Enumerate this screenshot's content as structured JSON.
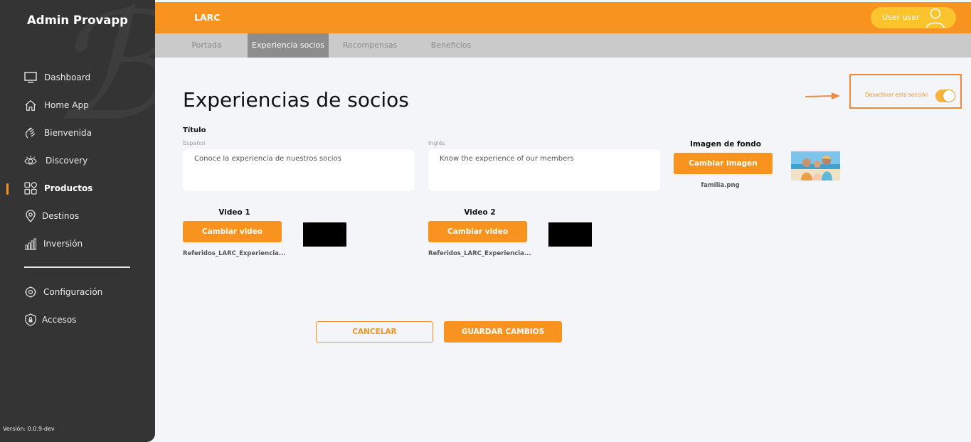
{
  "sidebar": {
    "brand": "Admin Provapp",
    "items": [
      {
        "label": "Dashboard",
        "icon": "monitor-icon"
      },
      {
        "label": "Home App",
        "icon": "home-icon"
      },
      {
        "label": "Bienvenida",
        "icon": "wave-hand-icon"
      },
      {
        "label": "Discovery",
        "icon": "eye-icon"
      },
      {
        "label": "Productos",
        "icon": "grid-icon",
        "active": true
      },
      {
        "label": "Destinos",
        "icon": "map-pin-icon"
      },
      {
        "label": "Inversión",
        "icon": "bar-chart-icon"
      },
      {
        "label": "Configuración",
        "icon": "gear-icon"
      },
      {
        "label": "Accesos",
        "icon": "shield-lock-icon"
      }
    ],
    "version": "Versión: 0.0.9-dev"
  },
  "header": {
    "app_name": "LARC",
    "user_name": "User user"
  },
  "tabs": [
    {
      "label": "Portada"
    },
    {
      "label": "Experiencia socios",
      "active": true
    },
    {
      "label": "Recompensas"
    },
    {
      "label": "Beneficios"
    }
  ],
  "main": {
    "title": "Experiencias de socios",
    "toggle_label": "Desactivar esta sección",
    "toggle_on": true,
    "field_title": "Título",
    "spanish_label": "Español",
    "spanish_value": "Conoce la experiencia de nuestros socios",
    "english_label": "Inglés",
    "english_value": "Know the experience of our members",
    "background": {
      "label": "Imagen de fondo",
      "button": "Cambiar imagen",
      "filename": "familia.png"
    },
    "video1": {
      "label": "Video 1",
      "button": "Cambiar video",
      "filename": "Referidos_LARC_Experiencia..."
    },
    "video2": {
      "label": "Video 2",
      "button": "Cambiar video",
      "filename": "Referidos_LARC_Experiencia..."
    },
    "cancel": "CANCELAR",
    "save": "GUARDAR CAMBIOS"
  },
  "colors": {
    "accent": "#f7931e",
    "sidebar_bg": "#343434",
    "tabbar_bg": "#cacaca",
    "tab_active_bg": "#8d8d8d",
    "user_chip_bg": "#fcc42c",
    "annotation": "#f08b3d"
  }
}
